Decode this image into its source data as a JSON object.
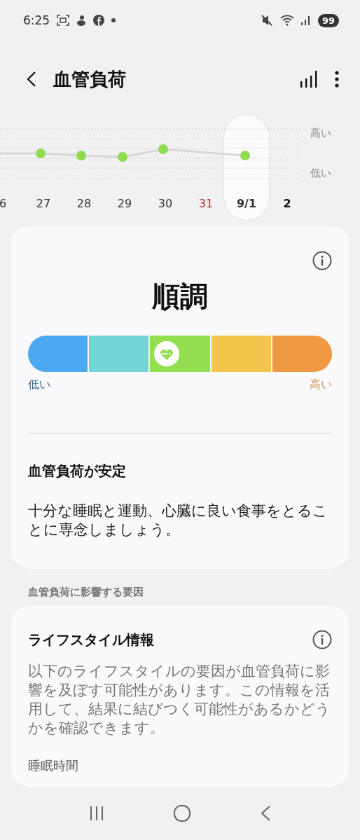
{
  "status_bar": {
    "time": "6:25",
    "battery": "99"
  },
  "header": {
    "title": "血管負荷"
  },
  "trend": {
    "high_label": "高い",
    "low_label": "低い",
    "dates": [
      {
        "label": "6",
        "color": "#333333",
        "emphasis": false,
        "selected": false
      },
      {
        "label": "27",
        "color": "#333333",
        "emphasis": false,
        "selected": false
      },
      {
        "label": "28",
        "color": "#333333",
        "emphasis": false,
        "selected": false
      },
      {
        "label": "29",
        "color": "#333333",
        "emphasis": false,
        "selected": false
      },
      {
        "label": "30",
        "color": "#333333",
        "emphasis": false,
        "selected": false
      },
      {
        "label": "31",
        "color": "#b0352f",
        "emphasis": false,
        "selected": false
      },
      {
        "label": "9/1",
        "color": "#333333",
        "emphasis": true,
        "selected": true
      },
      {
        "label": "2",
        "color": "#111111",
        "emphasis": true,
        "selected": false
      }
    ]
  },
  "status_card": {
    "status": "順調",
    "scale": [
      {
        "color": "#4eaaf0",
        "selected": false
      },
      {
        "color": "#72d6d6",
        "selected": false
      },
      {
        "color": "#93df4f",
        "selected": true
      },
      {
        "color": "#f5c54b",
        "selected": false
      },
      {
        "color": "#ef9a42",
        "selected": false
      }
    ],
    "low_label": "低い",
    "high_label": "高い",
    "heading": "血管負荷が安定",
    "body": "十分な睡眠と運動、心臓に良い食事をとることに専念しましょう。"
  },
  "section_label": "血管負荷に影響する要因",
  "lifestyle_card": {
    "title": "ライフスタイル情報",
    "body": "以下のライフスタイルの要因が血管負荷に影響を及ぼす可能性があります。この情報を活用して、結果に結びつく可能性があるかどうかを確認できます。",
    "items": [
      {
        "label": "睡眠時間"
      }
    ]
  }
}
